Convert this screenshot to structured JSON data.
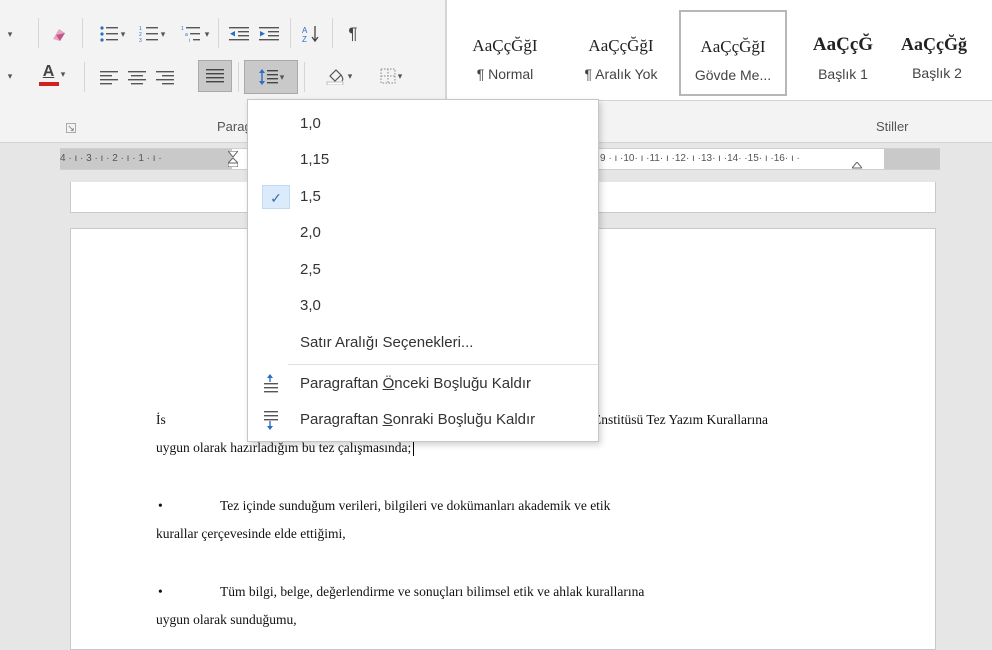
{
  "ribbon": {
    "paragraph_group_label": "Paragraf",
    "styles_group_label": "Stiller",
    "styles": [
      {
        "sample": "AaÇçĞğI",
        "name": "¶ Normal"
      },
      {
        "sample": "AaÇçĞğI",
        "name": "¶ Aralık Yok"
      },
      {
        "sample": "AaÇçĞğI",
        "name": "Gövde Me..."
      },
      {
        "sample": "AaÇçĞ",
        "name": "Başlık 1"
      },
      {
        "sample": "AaÇçĞğ",
        "name": "Başlık 2"
      }
    ],
    "font_color_letter": "A",
    "font_color_accent": "#d21f1f"
  },
  "ruler": {
    "left_text": "4 · ı · 3 · ı · 2 · ı · 1 · ı ·",
    "right_text": "9 · ı ·10· ı ·11· ı ·12· ı ·13· ı ·14·   ·15· ı ·16· ı ·"
  },
  "line_spacing_menu": {
    "options": [
      {
        "label": "1,0",
        "checked": false
      },
      {
        "label": "1,15",
        "checked": false
      },
      {
        "label": "1,5",
        "checked": true
      },
      {
        "label": "2,0",
        "checked": false
      },
      {
        "label": "2,5",
        "checked": false
      },
      {
        "label": "3,0",
        "checked": false
      }
    ],
    "more_options": "Satır Aralığı Seçenekleri...",
    "remove_before": {
      "pre": "Paragraftan ",
      "accel": "Ö",
      "post": "nceki Boşluğu Kaldır"
    },
    "remove_after": {
      "pre": "Paragraftan ",
      "accel": "S",
      "post": "onraki Boşluğu Kaldır"
    }
  },
  "document": {
    "line1_start": "İs",
    "line1_end": "Enstitüsü Tez Yazım Kurallarına",
    "line2": "uygun olarak hazırladığım bu tez çalışmasında;",
    "bullet1_a": "Tez içinde sunduğum verileri, bilgileri ve dokümanları akademik ve etik",
    "bullet1_b": "kurallar çerçevesinde elde ettiğimi,",
    "bullet2_a": "Tüm bilgi, belge, değerlendirme ve sonuçları bilimsel etik ve ahlak kurallarına",
    "bullet2_b": "uygun olarak sunduğumu,",
    "bullet_glyph": "•"
  },
  "colors": {
    "menu_check_bg": "#dcebfb",
    "ribbon_bg": "#f3f3f3"
  }
}
